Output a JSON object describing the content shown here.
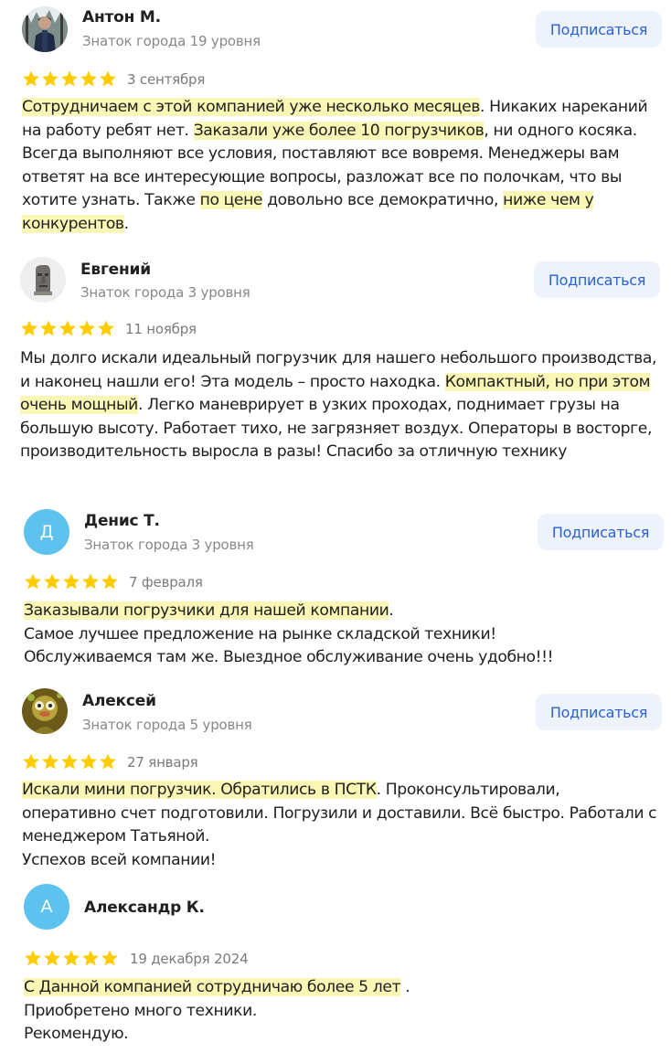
{
  "colors": {
    "star": "#ffcc00",
    "highlight": "#faf7b6",
    "subscribe_text": "#2962d6",
    "subscribe_bg": "#eef2fb",
    "avatar_letter_bg": "#5dc3ee"
  },
  "reviews": [
    {
      "author": "Антон М.",
      "level": "Знаток города 19 уровня",
      "subscribe_label": "Подписаться",
      "rating": 5,
      "date": "3 сентября",
      "avatar_icon": "person-in-winter-forest-photo",
      "text": [
        {
          "t": "Сотрудничаем с этой компанией уже несколько месяцев",
          "h": true
        },
        {
          "t": ". Никаких нареканий на работу ребят нет. ",
          "h": false
        },
        {
          "t": "Заказали уже более 10 погрузчиков",
          "h": true
        },
        {
          "t": ", ни одного косяка. Всегда выполняют все условия, поставляют все вовремя. Менеджеры вам ответят на все интересующие вопросы, разложат все по полочкам, что вы хотите узнать. Также ",
          "h": false
        },
        {
          "t": "по цене",
          "h": true
        },
        {
          "t": " довольно все демократично, ",
          "h": false
        },
        {
          "t": "ниже чем у конкурентов",
          "h": true
        },
        {
          "t": ".",
          "h": false
        }
      ]
    },
    {
      "author": "Евгений",
      "level": "Знаток города 3 уровня",
      "subscribe_label": "Подписаться",
      "rating": 5,
      "date": "11 ноября",
      "avatar_icon": "moai-statue-avatar",
      "text": [
        {
          "t": "Мы долго искали идеальный погрузчик для нашего небольшого производства, и наконец нашли его! Эта модель – просто находка. ",
          "h": false
        },
        {
          "t": "Компактный, но при этом очень мощный",
          "h": true
        },
        {
          "t": ". Легко маневрирует в узких проходах, поднимает грузы на большую высоту. Работает тихо, не загрязняет воздух. Операторы в восторге, производительность выросла в разы! Спасибо за отличную технику",
          "h": false
        }
      ]
    },
    {
      "author": "Денис Т.",
      "level": "Знаток города 3 уровня",
      "subscribe_label": "Подписаться",
      "rating": 5,
      "date": "7 февраля",
      "avatar_letter": "Д",
      "text": [
        {
          "t": "Заказывали погрузчики для нашей компании",
          "h": true
        },
        {
          "t": ".\nСамое лучшее предложение на рынке складской техники!\nОбслуживаемся там же. Выездное обслуживание очень удобно!!!",
          "h": false
        }
      ]
    },
    {
      "author": "Алексей",
      "level": "Знаток города 5 уровня",
      "subscribe_label": "Подписаться",
      "rating": 5,
      "date": "27 января",
      "avatar_icon": "cartoon-creature-avatar",
      "text": [
        {
          "t": "Искали мини погрузчик. Обратились в ПСТК",
          "h": true
        },
        {
          "t": ". Проконсультировали, оперативно счет подготовили. Погрузили и доставили. Всё быстро. Работали с менеджером Татьяной.\nУспехов всей компании!",
          "h": false
        }
      ]
    },
    {
      "author": "Александр К.",
      "rating": 5,
      "date": "19 декабря 2024",
      "avatar_letter": "А",
      "text": [
        {
          "t": "С Данной компанией сотрудничаю более 5 лет",
          "h": true
        },
        {
          "t": " .\nПриобретено много техники.\nРекомендую.",
          "h": false
        }
      ]
    }
  ]
}
